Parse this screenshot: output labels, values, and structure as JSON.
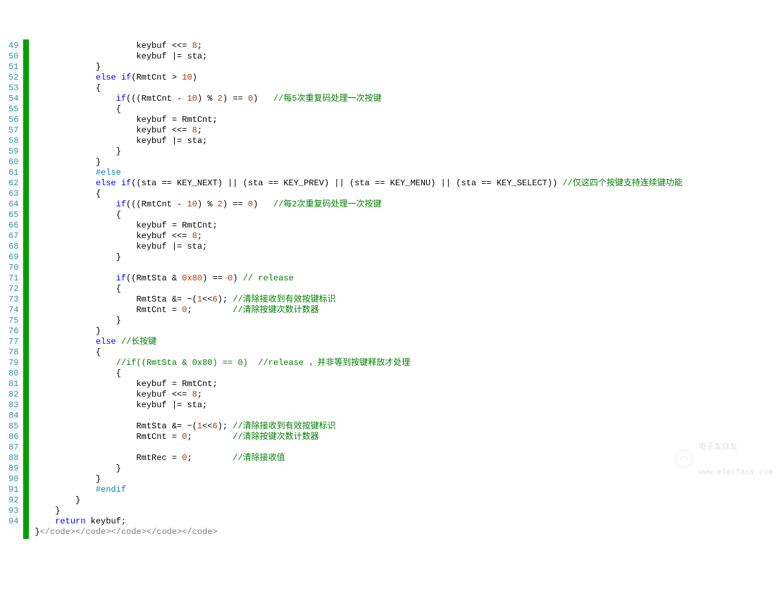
{
  "watermark": {
    "title": "电子发烧友",
    "url": "www.elecfans.com"
  },
  "lines": [
    {
      "n": 49,
      "indent": 20,
      "tokens": [
        {
          "t": "keybuf <<= ",
          "c": ""
        },
        {
          "t": "8",
          "c": "n"
        },
        {
          "t": ";",
          "c": ""
        }
      ]
    },
    {
      "n": 50,
      "indent": 20,
      "tokens": [
        {
          "t": "keybuf |= sta;",
          "c": ""
        }
      ]
    },
    {
      "n": 51,
      "indent": 12,
      "tokens": [
        {
          "t": "}",
          "c": ""
        }
      ]
    },
    {
      "n": 52,
      "indent": 12,
      "tokens": [
        {
          "t": "else if",
          "c": "k"
        },
        {
          "t": "(RmtCnt > ",
          "c": ""
        },
        {
          "t": "10",
          "c": "n"
        },
        {
          "t": ")",
          "c": ""
        }
      ]
    },
    {
      "n": 53,
      "indent": 12,
      "tokens": [
        {
          "t": "{",
          "c": ""
        }
      ]
    },
    {
      "n": 54,
      "indent": 16,
      "tokens": [
        {
          "t": "if",
          "c": "k"
        },
        {
          "t": "(((RmtCnt - ",
          "c": ""
        },
        {
          "t": "10",
          "c": "n"
        },
        {
          "t": ") % ",
          "c": ""
        },
        {
          "t": "2",
          "c": "n"
        },
        {
          "t": ") == ",
          "c": ""
        },
        {
          "t": "0",
          "c": "n"
        },
        {
          "t": ")   ",
          "c": ""
        },
        {
          "t": "//每5次重复码处理一次按键",
          "c": "c"
        }
      ]
    },
    {
      "n": 55,
      "indent": 16,
      "tokens": [
        {
          "t": "{",
          "c": ""
        }
      ]
    },
    {
      "n": 56,
      "indent": 20,
      "tokens": [
        {
          "t": "keybuf = RmtCnt;",
          "c": ""
        }
      ]
    },
    {
      "n": 57,
      "indent": 20,
      "tokens": [
        {
          "t": "keybuf <<= ",
          "c": ""
        },
        {
          "t": "8",
          "c": "n"
        },
        {
          "t": ";",
          "c": ""
        }
      ]
    },
    {
      "n": 58,
      "indent": 20,
      "tokens": [
        {
          "t": "keybuf |= sta;",
          "c": ""
        }
      ]
    },
    {
      "n": 59,
      "indent": 16,
      "tokens": [
        {
          "t": "}",
          "c": ""
        }
      ]
    },
    {
      "n": 60,
      "indent": 12,
      "tokens": [
        {
          "t": "}",
          "c": ""
        }
      ]
    },
    {
      "n": 61,
      "indent": 12,
      "tokens": [
        {
          "t": "#else",
          "c": "s"
        }
      ]
    },
    {
      "n": 62,
      "indent": 12,
      "tokens": [
        {
          "t": "else if",
          "c": "k"
        },
        {
          "t": "((sta == KEY_NEXT) || (sta == KEY_PREV) || (sta == KEY_MENU) || (sta == KEY_SELECT)) ",
          "c": ""
        },
        {
          "t": "//仅这四个按键支持连续键功能",
          "c": "c"
        }
      ]
    },
    {
      "n": 63,
      "indent": 12,
      "tokens": [
        {
          "t": "{",
          "c": ""
        }
      ]
    },
    {
      "n": 64,
      "indent": 16,
      "tokens": [
        {
          "t": "if",
          "c": "k"
        },
        {
          "t": "(((RmtCnt - ",
          "c": ""
        },
        {
          "t": "10",
          "c": "n"
        },
        {
          "t": ") % ",
          "c": ""
        },
        {
          "t": "2",
          "c": "n"
        },
        {
          "t": ") == ",
          "c": ""
        },
        {
          "t": "0",
          "c": "n"
        },
        {
          "t": ")   ",
          "c": ""
        },
        {
          "t": "//每2次重复码处理一次按键",
          "c": "c"
        }
      ]
    },
    {
      "n": 65,
      "indent": 16,
      "tokens": [
        {
          "t": "{",
          "c": ""
        }
      ]
    },
    {
      "n": 66,
      "indent": 20,
      "tokens": [
        {
          "t": "keybuf = RmtCnt;",
          "c": ""
        }
      ]
    },
    {
      "n": 67,
      "indent": 20,
      "tokens": [
        {
          "t": "keybuf <<= ",
          "c": ""
        },
        {
          "t": "8",
          "c": "n"
        },
        {
          "t": ";",
          "c": ""
        }
      ]
    },
    {
      "n": 68,
      "indent": 20,
      "tokens": [
        {
          "t": "keybuf |= sta;",
          "c": ""
        }
      ]
    },
    {
      "n": 69,
      "indent": 16,
      "tokens": [
        {
          "t": "}",
          "c": ""
        }
      ]
    },
    {
      "n": 70,
      "indent": 12,
      "tokens": []
    },
    {
      "n": 71,
      "indent": 16,
      "tokens": [
        {
          "t": "if",
          "c": "k"
        },
        {
          "t": "((RmtSta & ",
          "c": ""
        },
        {
          "t": "0x80",
          "c": "n"
        },
        {
          "t": ") == ",
          "c": ""
        },
        {
          "t": "0",
          "c": "n"
        },
        {
          "t": ") ",
          "c": ""
        },
        {
          "t": "// release",
          "c": "c"
        }
      ]
    },
    {
      "n": 72,
      "indent": 16,
      "tokens": [
        {
          "t": "{",
          "c": ""
        }
      ]
    },
    {
      "n": 73,
      "indent": 20,
      "tokens": [
        {
          "t": "RmtSta &= ~(",
          "c": ""
        },
        {
          "t": "1",
          "c": "n"
        },
        {
          "t": "<<",
          "c": ""
        },
        {
          "t": "6",
          "c": "n"
        },
        {
          "t": "); ",
          "c": ""
        },
        {
          "t": "//清除接收到有效按键标识",
          "c": "c"
        }
      ]
    },
    {
      "n": 74,
      "indent": 20,
      "tokens": [
        {
          "t": "RmtCnt = ",
          "c": ""
        },
        {
          "t": "0",
          "c": "n"
        },
        {
          "t": ";        ",
          "c": ""
        },
        {
          "t": "//清除按键次数计数器",
          "c": "c"
        }
      ]
    },
    {
      "n": 75,
      "indent": 16,
      "tokens": [
        {
          "t": "}",
          "c": ""
        }
      ]
    },
    {
      "n": 76,
      "indent": 12,
      "tokens": [
        {
          "t": "}",
          "c": ""
        }
      ]
    },
    {
      "n": 77,
      "indent": 12,
      "tokens": [
        {
          "t": "else",
          "c": "k"
        },
        {
          "t": " ",
          "c": ""
        },
        {
          "t": "//长按键",
          "c": "c"
        }
      ]
    },
    {
      "n": 78,
      "indent": 12,
      "tokens": [
        {
          "t": "{",
          "c": ""
        }
      ]
    },
    {
      "n": 79,
      "indent": 16,
      "tokens": [
        {
          "t": "//if((RmtSta & 0x80) == 0)  //release ，并非等到按键释放才处理",
          "c": "c"
        }
      ]
    },
    {
      "n": 80,
      "indent": 16,
      "tokens": [
        {
          "t": "{",
          "c": ""
        }
      ]
    },
    {
      "n": 81,
      "indent": 20,
      "tokens": [
        {
          "t": "keybuf = RmtCnt;",
          "c": ""
        }
      ]
    },
    {
      "n": 82,
      "indent": 20,
      "tokens": [
        {
          "t": "keybuf <<= ",
          "c": ""
        },
        {
          "t": "8",
          "c": "n"
        },
        {
          "t": ";",
          "c": ""
        }
      ]
    },
    {
      "n": 83,
      "indent": 20,
      "tokens": [
        {
          "t": "keybuf |= sta;",
          "c": ""
        }
      ]
    },
    {
      "n": 84,
      "indent": 20,
      "tokens": []
    },
    {
      "n": 85,
      "indent": 20,
      "tokens": [
        {
          "t": "RmtSta &= ~(",
          "c": ""
        },
        {
          "t": "1",
          "c": "n"
        },
        {
          "t": "<<",
          "c": ""
        },
        {
          "t": "6",
          "c": "n"
        },
        {
          "t": "); ",
          "c": ""
        },
        {
          "t": "//清除接收到有效按键标识",
          "c": "c"
        }
      ]
    },
    {
      "n": 86,
      "indent": 20,
      "tokens": [
        {
          "t": "RmtCnt = ",
          "c": ""
        },
        {
          "t": "0",
          "c": "n"
        },
        {
          "t": ";        ",
          "c": ""
        },
        {
          "t": "//清除按键次数计数器",
          "c": "c"
        }
      ]
    },
    {
      "n": 87,
      "indent": 20,
      "tokens": []
    },
    {
      "n": 88,
      "indent": 20,
      "tokens": [
        {
          "t": "RmtRec = ",
          "c": ""
        },
        {
          "t": "0",
          "c": "n"
        },
        {
          "t": ";        ",
          "c": ""
        },
        {
          "t": "//清除接收值",
          "c": "c"
        }
      ]
    },
    {
      "n": 89,
      "indent": 16,
      "tokens": [
        {
          "t": "}",
          "c": ""
        }
      ]
    },
    {
      "n": 90,
      "indent": 12,
      "tokens": [
        {
          "t": "}",
          "c": ""
        }
      ]
    },
    {
      "n": 91,
      "indent": 12,
      "tokens": [
        {
          "t": "#endif",
          "c": "s"
        }
      ]
    },
    {
      "n": 92,
      "indent": 8,
      "tokens": [
        {
          "t": "}",
          "c": ""
        }
      ]
    },
    {
      "n": 93,
      "indent": 4,
      "tokens": [
        {
          "t": "}",
          "c": ""
        }
      ]
    },
    {
      "n": 94,
      "indent": 4,
      "tokens": [
        {
          "t": "return",
          "c": "k"
        },
        {
          "t": " keybuf;",
          "c": ""
        }
      ]
    },
    {
      "n": "",
      "indent": 0,
      "tokens": [
        {
          "t": "}",
          "c": ""
        },
        {
          "t": "</code></code></code></code></code>",
          "c": "p"
        }
      ]
    }
  ]
}
